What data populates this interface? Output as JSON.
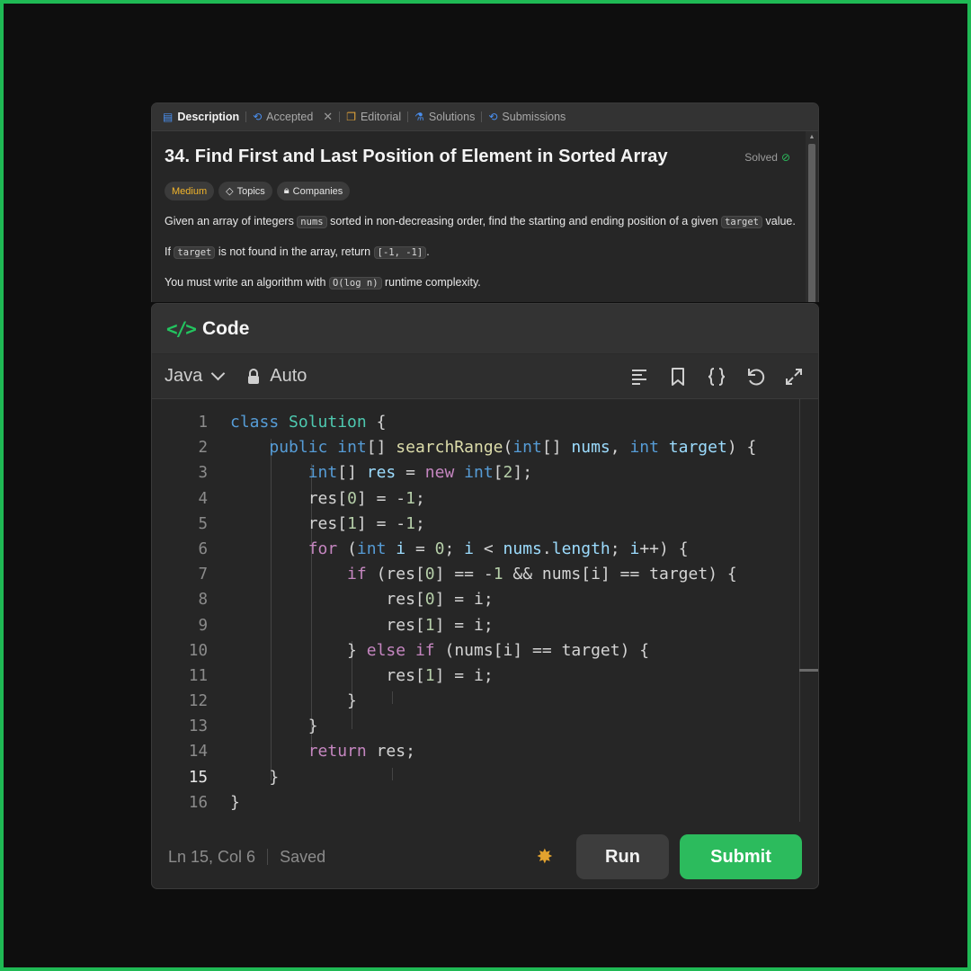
{
  "tabs": [
    {
      "label": "Description",
      "icon": "description-icon",
      "active": true
    },
    {
      "label": "Accepted",
      "icon": "history-icon",
      "closable": true
    },
    {
      "label": "Editorial",
      "icon": "book-icon"
    },
    {
      "label": "Solutions",
      "icon": "flask-icon"
    },
    {
      "label": "Submissions",
      "icon": "history-icon"
    }
  ],
  "problem": {
    "title": "34. Find First and Last Position of Element in Sorted Array",
    "status": "Solved",
    "difficulty": "Medium",
    "tags": [
      "Topics",
      "Companies"
    ],
    "para1": {
      "t1": "Given an array of integers ",
      "c1": "nums",
      "t2": " sorted in non-decreasing order, find the starting and ending position of a given ",
      "c2": "target",
      "t3": " value."
    },
    "para2": {
      "t1": "If ",
      "c1": "target",
      "t2": " is not found in the array, return ",
      "c2": "[-1, -1]",
      "t3": "."
    },
    "para3": {
      "t1": "You must write an algorithm with ",
      "c1": "O(log n)",
      "t2": " runtime complexity."
    }
  },
  "code_panel": {
    "title": "Code",
    "language": "Java",
    "mode": "Auto",
    "lines": [
      "class Solution {",
      "    public int[] searchRange(int[] nums, int target) {",
      "        int[] res = new int[2];",
      "        res[0] = -1;",
      "        res[1] = -1;",
      "        for (int i = 0; i < nums.length; i++) {",
      "            if (res[0] == -1 && nums[i] == target) {",
      "                res[0] = i;",
      "                res[1] = i;",
      "            } else if (nums[i] == target) {",
      "                res[1] = i;",
      "            }",
      "        }",
      "        return res;",
      "    }",
      "}"
    ],
    "line_numbers": [
      "1",
      "2",
      "3",
      "4",
      "5",
      "6",
      "7",
      "8",
      "9",
      "10",
      "11",
      "12",
      "13",
      "14",
      "15",
      "16"
    ],
    "current_line": 15
  },
  "status": {
    "cursor": "Ln 15, Col 6",
    "saved": "Saved",
    "run_label": "Run",
    "submit_label": "Submit"
  },
  "colors": {
    "accent_green": "#2cbb5d",
    "difficulty_medium": "#f2b52b",
    "frame_border": "#1fb954"
  }
}
